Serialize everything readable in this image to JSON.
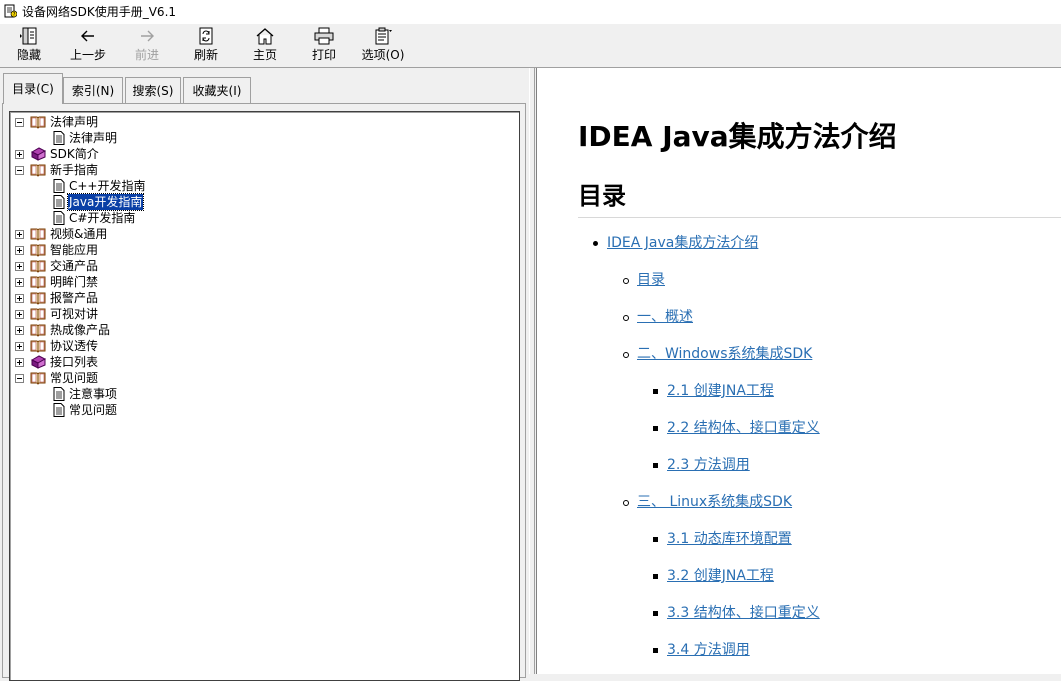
{
  "window": {
    "title": "设备网络SDK使用手册_V6.1"
  },
  "toolbar": {
    "hide": "隐藏",
    "back": "上一步",
    "forward": "前进",
    "refresh": "刷新",
    "home": "主页",
    "print": "打印",
    "options": "选项(O)"
  },
  "tabs": {
    "contents": "目录(C)",
    "index": "索引(N)",
    "search": "搜索(S)",
    "favorites": "收藏夹(I)"
  },
  "tree": [
    {
      "label": "法律声明",
      "icon": "open-book-icon",
      "expander": "minus"
    },
    {
      "label": "法律声明",
      "icon": "page-icon"
    },
    {
      "label": "SDK简介",
      "icon": "closed-book-icon",
      "expander": "plus"
    },
    {
      "label": "新手指南",
      "icon": "open-book-icon",
      "expander": "minus"
    },
    {
      "label": "C++开发指南",
      "icon": "page-icon"
    },
    {
      "label": "Java开发指南",
      "icon": "page-icon",
      "selected": true
    },
    {
      "label": "C#开发指南",
      "icon": "page-icon"
    },
    {
      "label": "视频&通用",
      "icon": "open-book-icon",
      "expander": "plus"
    },
    {
      "label": "智能应用",
      "icon": "open-book-icon",
      "expander": "plus"
    },
    {
      "label": "交通产品",
      "icon": "open-book-icon",
      "expander": "plus"
    },
    {
      "label": "明眸门禁",
      "icon": "open-book-icon",
      "expander": "plus"
    },
    {
      "label": "报警产品",
      "icon": "open-book-icon",
      "expander": "plus"
    },
    {
      "label": "可视对讲",
      "icon": "open-book-icon",
      "expander": "plus"
    },
    {
      "label": "热成像产品",
      "icon": "open-book-icon",
      "expander": "plus"
    },
    {
      "label": "协议透传",
      "icon": "open-book-icon",
      "expander": "plus"
    },
    {
      "label": "接口列表",
      "icon": "closed-book-icon",
      "expander": "plus"
    },
    {
      "label": "常见问题",
      "icon": "open-book-icon",
      "expander": "minus"
    },
    {
      "label": "注意事项",
      "icon": "page-icon"
    },
    {
      "label": "常见问题",
      "icon": "page-icon"
    }
  ],
  "content": {
    "title": "IDEA Java集成方法介绍",
    "toc_heading": "目录",
    "toc": [
      {
        "text": "IDEA Java集成方法介绍",
        "level": 1
      },
      {
        "text": "目录",
        "level": 2
      },
      {
        "text": "一、概述",
        "level": 2
      },
      {
        "text": "二、Windows系统集成SDK",
        "level": 2
      },
      {
        "text": "2.1 创建JNA工程",
        "level": 3
      },
      {
        "text": "2.2 结构体、接口重定义",
        "level": 3
      },
      {
        "text": "2.3 方法调用",
        "level": 3
      },
      {
        "text": "三、 Linux系统集成SDK",
        "level": 2
      },
      {
        "text": "3.1 动态库环境配置",
        "level": 3
      },
      {
        "text": "3.2 创建JNA工程",
        "level": 3
      },
      {
        "text": "3.3 结构体、接口重定义",
        "level": 3
      },
      {
        "text": "3.4 方法调用",
        "level": 3
      }
    ]
  },
  "colors": {
    "link": "#2a6fb3",
    "selection": "#0a3fa6"
  }
}
